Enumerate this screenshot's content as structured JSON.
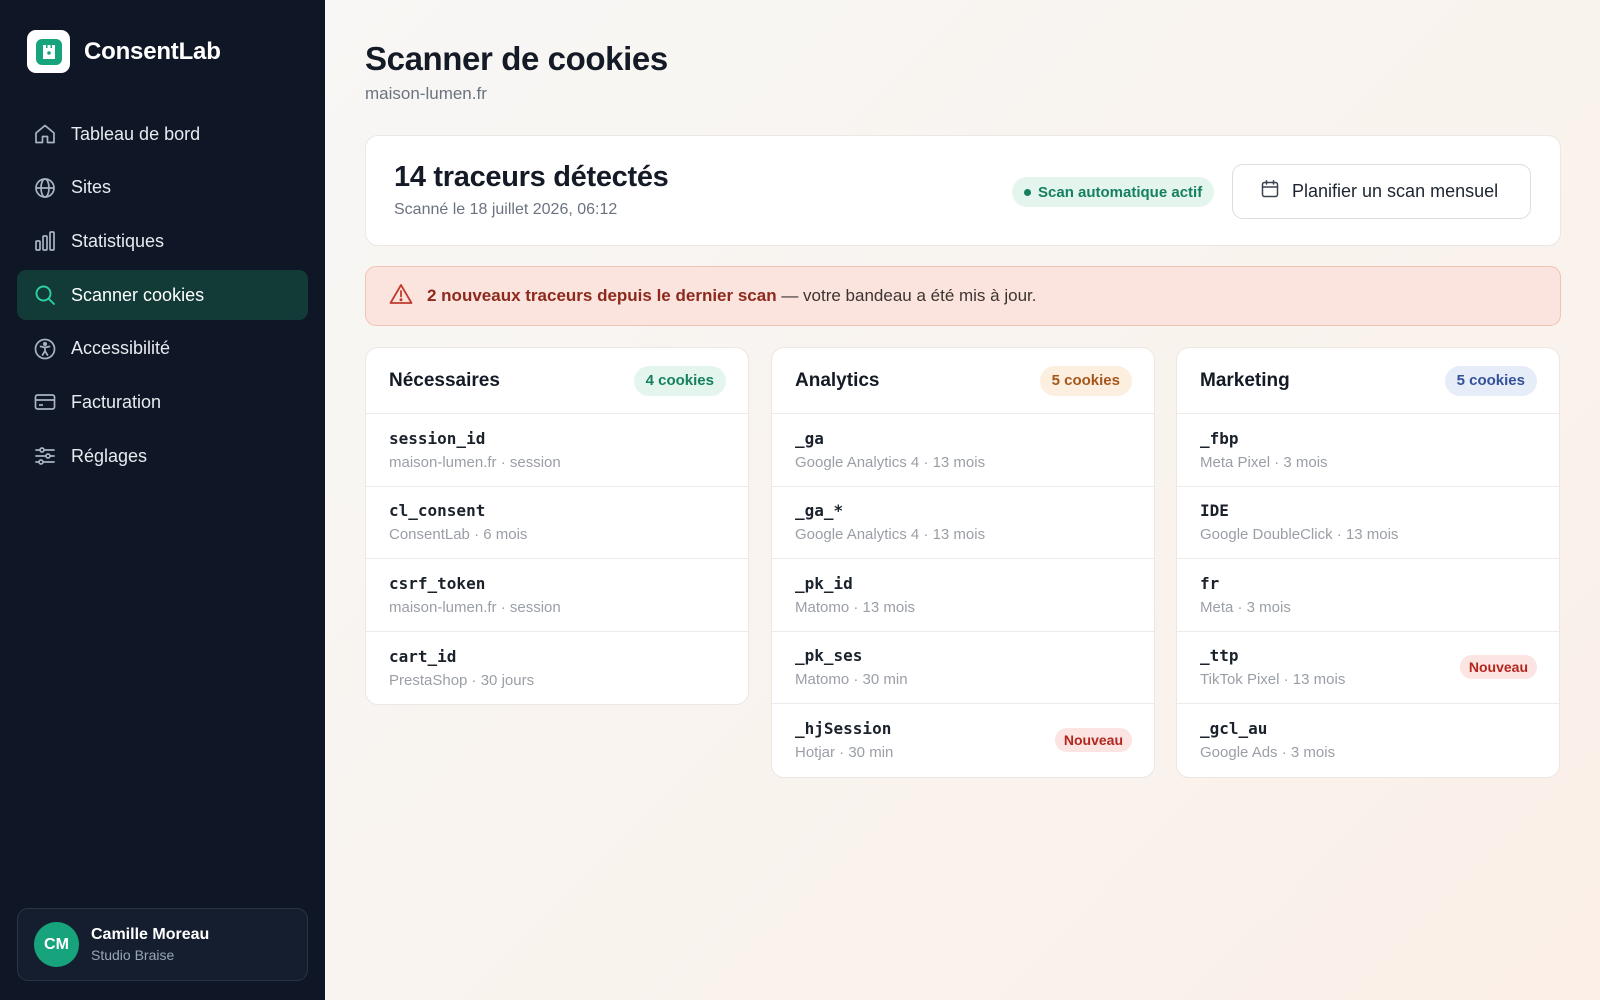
{
  "app": {
    "name": "ConsentLab"
  },
  "sidebar": {
    "items": [
      {
        "label": "Tableau de bord",
        "icon": "home-icon",
        "active": false
      },
      {
        "label": "Sites",
        "icon": "globe-icon",
        "active": false
      },
      {
        "label": "Statistiques",
        "icon": "bar-chart-icon",
        "active": false
      },
      {
        "label": "Scanner cookies",
        "icon": "search-icon",
        "active": true
      },
      {
        "label": "Accessibilité",
        "icon": "accessibility-icon",
        "active": false
      },
      {
        "label": "Facturation",
        "icon": "credit-card-icon",
        "active": false
      },
      {
        "label": "Réglages",
        "icon": "sliders-icon",
        "active": false
      }
    ]
  },
  "user": {
    "initials": "CM",
    "name": "Camille Moreau",
    "org": "Studio Braise"
  },
  "header": {
    "title": "Scanner de cookies",
    "site": "maison-lumen.fr"
  },
  "summary": {
    "title": "14 traceurs détectés",
    "date": "Scanné le 18 juillet 2026, 06:12",
    "auto_badge": "Scan automatique actif",
    "plan_button": "Planifier un scan mensuel"
  },
  "alert": {
    "strong": "2 nouveaux traceurs depuis le dernier scan",
    "rest": " — votre bandeau a été mis à jour."
  },
  "columns": [
    {
      "title": "Nécessaires",
      "count": "4 cookies",
      "badge_bg": "#e4f5ee",
      "badge_color": "#15805f",
      "cookies": [
        {
          "name": "session_id",
          "meta": "maison-lumen.fr · session",
          "badge": ""
        },
        {
          "name": "cl_consent",
          "meta": "ConsentLab · 6 mois",
          "badge": ""
        },
        {
          "name": "csrf_token",
          "meta": "maison-lumen.fr · session",
          "badge": ""
        },
        {
          "name": "cart_id",
          "meta": "PrestaShop · 30 jours",
          "badge": ""
        }
      ]
    },
    {
      "title": "Analytics",
      "count": "5 cookies",
      "badge_bg": "#fcefdf",
      "badge_color": "#a5571b",
      "cookies": [
        {
          "name": "_ga",
          "meta": "Google Analytics 4 · 13 mois",
          "badge": ""
        },
        {
          "name": "_ga_*",
          "meta": "Google Analytics 4 · 13 mois",
          "badge": ""
        },
        {
          "name": "_pk_id",
          "meta": "Matomo · 13 mois",
          "badge": ""
        },
        {
          "name": "_pk_ses",
          "meta": "Matomo · 30 min",
          "badge": ""
        },
        {
          "name": "_hjSession",
          "meta": "Hotjar · 30 min",
          "badge": "Nouveau"
        }
      ]
    },
    {
      "title": "Marketing",
      "count": "5 cookies",
      "badge_bg": "#e6ecf8",
      "badge_color": "#34519a",
      "cookies": [
        {
          "name": "_fbp",
          "meta": "Meta Pixel · 3 mois",
          "badge": ""
        },
        {
          "name": "IDE",
          "meta": "Google DoubleClick · 13 mois",
          "badge": ""
        },
        {
          "name": "fr",
          "meta": "Meta · 3 mois",
          "badge": ""
        },
        {
          "name": "_ttp",
          "meta": "TikTok Pixel · 13 mois",
          "badge": "Nouveau"
        },
        {
          "name": "_gcl_au",
          "meta": "Google Ads · 3 mois",
          "badge": ""
        }
      ]
    }
  ]
}
